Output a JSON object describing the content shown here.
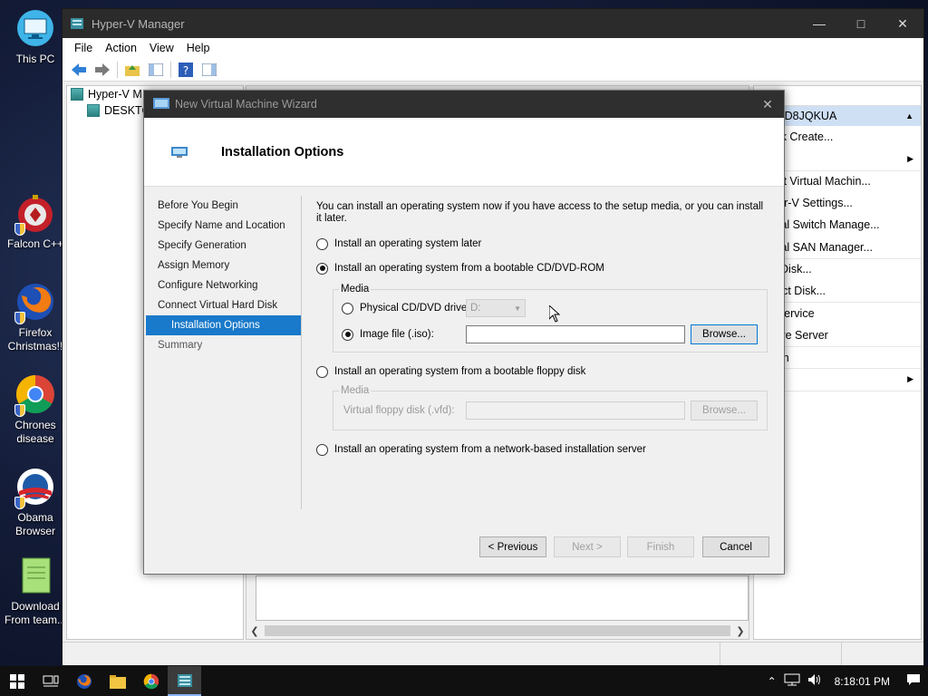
{
  "desktop": {
    "icons": [
      {
        "label": "This PC"
      },
      {
        "label": "Falcon C++"
      },
      {
        "label": "Firefox Christmas!!"
      },
      {
        "label": "Chrones disease"
      },
      {
        "label": "Obama Browser"
      },
      {
        "label": "Download From team..."
      }
    ]
  },
  "hyperv": {
    "title": "Hyper-V Manager",
    "menu": [
      "File",
      "Action",
      "View",
      "Help"
    ],
    "tree": {
      "root": "Hyper-V M",
      "child": "DESKTO"
    },
    "actions": {
      "header": "ns",
      "section": "TOP-D8JQKUA",
      "items": [
        {
          "label": "Quick Create...",
          "submenu": false
        },
        {
          "label": "New",
          "submenu": true
        },
        {
          "label": "mport Virtual Machin...",
          "submenu": false
        },
        {
          "label": "Hyper-V Settings...",
          "submenu": false
        },
        {
          "label": "Virtual Switch Manage...",
          "submenu": false
        },
        {
          "label": "Virtual SAN Manager...",
          "submenu": false
        },
        {
          "label": "Edit Disk...",
          "submenu": false
        },
        {
          "label": "nspect Disk...",
          "submenu": false
        },
        {
          "label": "top Service",
          "submenu": false
        },
        {
          "label": "emove Server",
          "submenu": false
        },
        {
          "label": "efresh",
          "submenu": false
        },
        {
          "label": "iew",
          "submenu": true
        },
        {
          "label": "Help",
          "submenu": false
        }
      ]
    }
  },
  "wizard": {
    "title": "New Virtual Machine Wizard",
    "heading": "Installation Options",
    "steps": [
      {
        "label": "Before You Begin",
        "state": "normal"
      },
      {
        "label": "Specify Name and Location",
        "state": "normal"
      },
      {
        "label": "Specify Generation",
        "state": "normal"
      },
      {
        "label": "Assign Memory",
        "state": "normal"
      },
      {
        "label": "Configure Networking",
        "state": "normal"
      },
      {
        "label": "Connect Virtual Hard Disk",
        "state": "normal"
      },
      {
        "label": "Installation Options",
        "state": "active"
      },
      {
        "label": "Summary",
        "state": "dim"
      }
    ],
    "intro": "You can install an operating system now if you have access to the setup media, or you can install it later.",
    "option_later": "Install an operating system later",
    "option_cd": "Install an operating system from a bootable CD/DVD-ROM",
    "media_label": "Media",
    "physical_drive_label": "Physical CD/DVD drive:",
    "drive_value": "D:",
    "image_file_label": "Image file (.iso):",
    "image_file_value": "",
    "browse_label": "Browse...",
    "option_floppy": "Install an operating system from a bootable floppy disk",
    "floppy_media_label": "Media",
    "floppy_label": "Virtual floppy disk (.vfd):",
    "floppy_browse_label": "Browse...",
    "option_network": "Install an operating system from a network-based installation server",
    "buttons": {
      "previous": "< Previous",
      "next": "Next >",
      "finish": "Finish",
      "cancel": "Cancel"
    }
  },
  "taskbar": {
    "time": "8:18:01 PM"
  }
}
